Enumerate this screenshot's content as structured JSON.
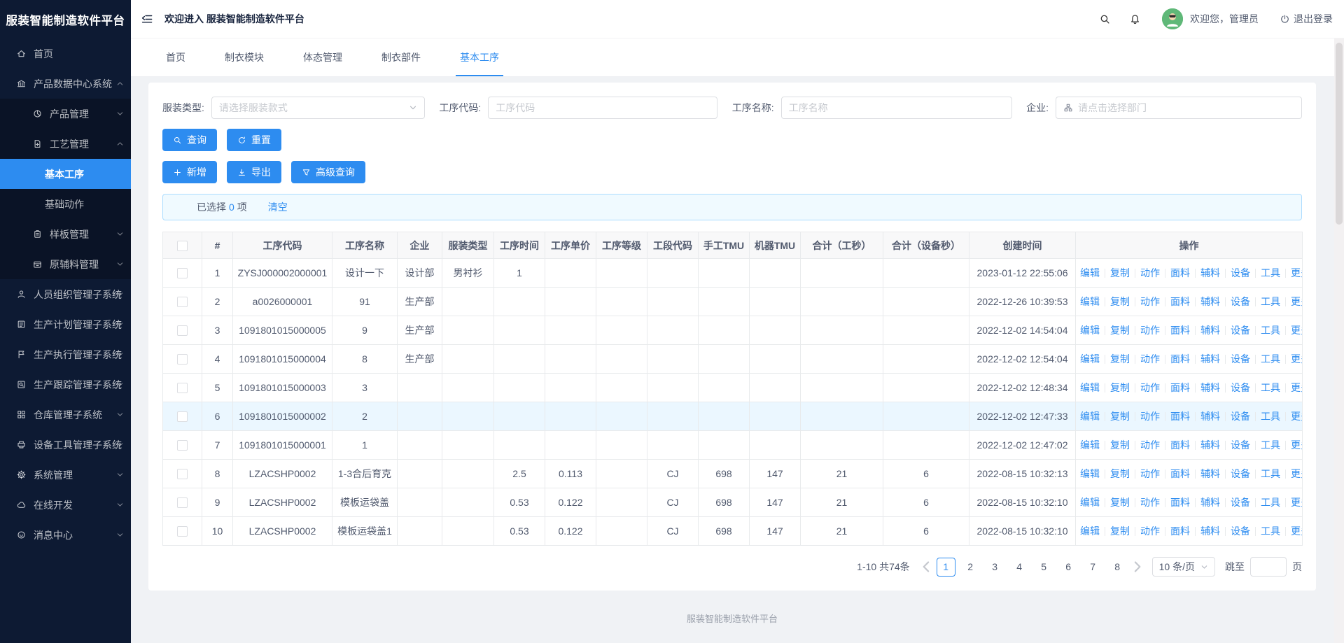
{
  "app": {
    "title": "服装智能制造软件平台",
    "welcome": "欢迎进入 服装智能制造软件平台",
    "footer": "服装智能制造软件平台",
    "accent_color": "#2d8cf0",
    "sidebar_color": "#0d1a33"
  },
  "header": {
    "icons": [
      "menu-fold-icon",
      "search-icon",
      "bell-icon",
      "logout-icon"
    ],
    "user_greeting": "欢迎您，管理员",
    "logout_label": "退出登录"
  },
  "sidebar": {
    "items": [
      {
        "label": "首页",
        "icon": "home-icon",
        "level": 1
      },
      {
        "label": "产品数据中心系统",
        "icon": "bank-icon",
        "level": 1,
        "arrow": "up"
      },
      {
        "label": "产品管理",
        "icon": "pie-chart-icon",
        "level": 2,
        "arrow": "down"
      },
      {
        "label": "工艺管理",
        "icon": "file-add-icon",
        "level": 2,
        "arrow": "up"
      },
      {
        "label": "基本工序",
        "level": 3,
        "active": true
      },
      {
        "label": "基础动作",
        "level": 3
      },
      {
        "label": "样板管理",
        "icon": "clipboard-icon",
        "level": 2,
        "arrow": "down"
      },
      {
        "label": "原辅料管理",
        "icon": "box-icon",
        "level": 2,
        "arrow": "down"
      },
      {
        "label": "人员组织管理子系统",
        "icon": "user-icon",
        "level": 1,
        "arrow": "down"
      },
      {
        "label": "生产计划管理子系统",
        "icon": "plan-icon",
        "level": 1,
        "arrow": "down"
      },
      {
        "label": "生产执行管理子系统",
        "icon": "flag-icon",
        "level": 1,
        "arrow": "down"
      },
      {
        "label": "生产跟踪管理子系统",
        "icon": "track-icon",
        "level": 1,
        "arrow": "down"
      },
      {
        "label": "仓库管理子系统",
        "icon": "warehouse-icon",
        "level": 1,
        "arrow": "down"
      },
      {
        "label": "设备工具管理子系统",
        "icon": "device-icon",
        "level": 1,
        "arrow": "down"
      },
      {
        "label": "系统管理",
        "icon": "gear-icon",
        "level": 1,
        "arrow": "down"
      },
      {
        "label": "在线开发",
        "icon": "cloud-icon",
        "level": 1,
        "arrow": "down"
      },
      {
        "label": "消息中心",
        "icon": "message-icon",
        "level": 1,
        "arrow": "down"
      }
    ]
  },
  "tabs": [
    {
      "label": "首页",
      "active": false
    },
    {
      "label": "制衣模块",
      "active": false
    },
    {
      "label": "体态管理",
      "active": false
    },
    {
      "label": "制衣部件",
      "active": false
    },
    {
      "label": "基本工序",
      "active": true
    }
  ],
  "filters": [
    {
      "label": "服装类型:",
      "placeholder": "请选择服装款式",
      "type": "select"
    },
    {
      "label": "工序代码:",
      "placeholder": "工序代码",
      "type": "input"
    },
    {
      "label": "工序名称:",
      "placeholder": "工序名称",
      "type": "input"
    },
    {
      "label": "企业:",
      "placeholder": "请点击选择部门",
      "type": "dept",
      "icon": "department-icon"
    }
  ],
  "actions": {
    "search": "查询",
    "search_icon": "search-icon",
    "reset": "重置",
    "reset_icon": "refresh-icon",
    "add": "新增",
    "add_icon": "plus-icon",
    "export": "导出",
    "export_icon": "download-icon",
    "advanced": "高级查询",
    "advanced_icon": "filter-icon"
  },
  "selection": {
    "label_prefix": "已选择",
    "count": "0",
    "label_suffix": "项",
    "clear_label": "清空"
  },
  "table": {
    "columns": [
      "#",
      "工序代码",
      "工序名称",
      "企业",
      "服装类型",
      "工序时间",
      "工序单价",
      "工序等级",
      "工段代码",
      "手工TMU",
      "机器TMU",
      "合计（工秒）",
      "合计（设备秒）",
      "创建时间",
      "操作"
    ],
    "op_links": [
      "编辑",
      "复制",
      "动作",
      "面料",
      "辅料",
      "设备",
      "工具"
    ],
    "more_label": "更多",
    "rows": [
      {
        "highlighted": false,
        "cells": [
          "1",
          "ZYSJ000002000001",
          "设计一下",
          "设计部",
          "男衬衫",
          "1",
          "",
          "",
          "",
          "",
          "",
          "",
          "",
          "2023-01-12 22:55:06"
        ]
      },
      {
        "highlighted": false,
        "cells": [
          "2",
          "a0026000001",
          "91",
          "生产部",
          "",
          "",
          "",
          "",
          "",
          "",
          "",
          "",
          "",
          "2022-12-26 10:39:53"
        ]
      },
      {
        "highlighted": false,
        "cells": [
          "3",
          "1091801015000005",
          "9",
          "生产部",
          "",
          "",
          "",
          "",
          "",
          "",
          "",
          "",
          "",
          "2022-12-02 14:54:04"
        ]
      },
      {
        "highlighted": false,
        "cells": [
          "4",
          "1091801015000004",
          "8",
          "生产部",
          "",
          "",
          "",
          "",
          "",
          "",
          "",
          "",
          "",
          "2022-12-02 12:54:04"
        ]
      },
      {
        "highlighted": false,
        "cells": [
          "5",
          "1091801015000003",
          "3",
          "",
          "",
          "",
          "",
          "",
          "",
          "",
          "",
          "",
          "",
          "2022-12-02 12:48:34"
        ]
      },
      {
        "highlighted": true,
        "cells": [
          "6",
          "1091801015000002",
          "2",
          "",
          "",
          "",
          "",
          "",
          "",
          "",
          "",
          "",
          "",
          "2022-12-02 12:47:33"
        ]
      },
      {
        "highlighted": false,
        "cells": [
          "7",
          "1091801015000001",
          "1",
          "",
          "",
          "",
          "",
          "",
          "",
          "",
          "",
          "",
          "",
          "2022-12-02 12:47:02"
        ]
      },
      {
        "highlighted": false,
        "cells": [
          "8",
          "LZACSHP0002",
          "1-3合后育克",
          "",
          "",
          "2.5",
          "0.113",
          "",
          "CJ",
          "698",
          "147",
          "21",
          "6",
          "2022-08-15 10:32:13"
        ]
      },
      {
        "highlighted": false,
        "cells": [
          "9",
          "LZACSHP0002",
          "模板运袋盖",
          "",
          "",
          "0.53",
          "0.122",
          "",
          "CJ",
          "698",
          "147",
          "21",
          "6",
          "2022-08-15 10:32:10"
        ]
      },
      {
        "highlighted": false,
        "cells": [
          "10",
          "LZACSHP0002",
          "模板运袋盖1",
          "",
          "",
          "0.53",
          "0.122",
          "",
          "CJ",
          "698",
          "147",
          "21",
          "6",
          "2022-08-15 10:32:10"
        ]
      }
    ]
  },
  "pagination": {
    "total_text": "1-10 共74条",
    "pages": [
      "1",
      "2",
      "3",
      "4",
      "5",
      "6",
      "7",
      "8"
    ],
    "current_page": "1",
    "page_size": "10 条/页",
    "jump_label": "跳至",
    "page_label": "页"
  }
}
